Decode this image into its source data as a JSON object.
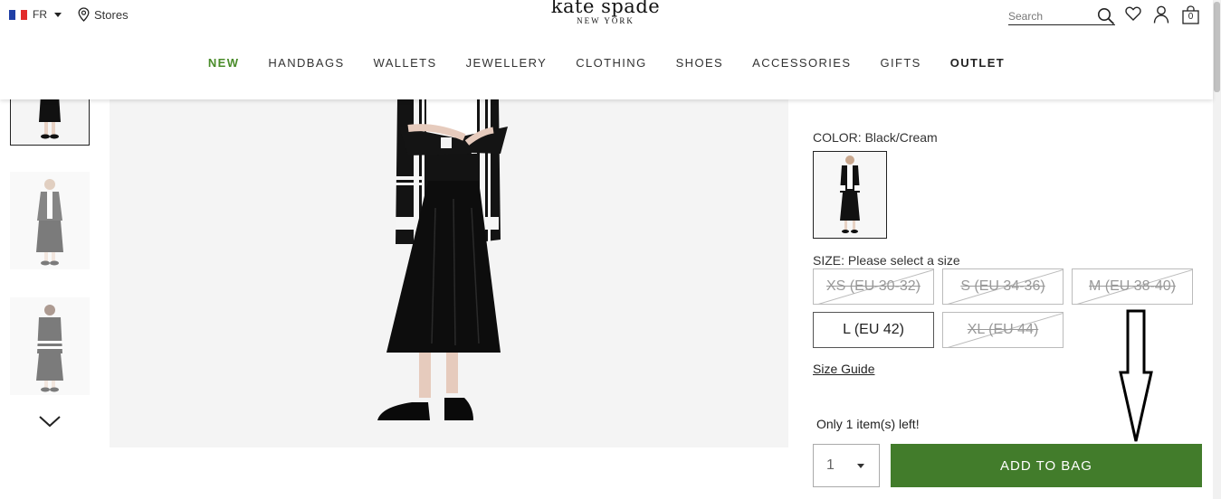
{
  "header": {
    "locale": "FR",
    "stores_label": "Stores",
    "logo_main": "kate spade",
    "logo_sub": "NEW YORK",
    "search_placeholder": "Search",
    "bag_count": "0"
  },
  "nav": {
    "items": [
      "NEW",
      "HANDBAGS",
      "WALLETS",
      "JEWELLERY",
      "CLOTHING",
      "SHOES",
      "ACCESSORIES",
      "GIFTS",
      "OUTLET"
    ]
  },
  "product": {
    "color_label": "COLOR:",
    "color_value": "Black/Cream",
    "size_label": "SIZE:",
    "size_prompt": "Please select a size",
    "sizes": [
      {
        "label": "XS (EU 30-32)",
        "available": false
      },
      {
        "label": "S (EU 34-36)",
        "available": false
      },
      {
        "label": "M (EU 38-40)",
        "available": false
      },
      {
        "label": "L (EU 42)",
        "available": true
      },
      {
        "label": "XL (EU 44)",
        "available": false
      }
    ],
    "size_guide": "Size Guide",
    "stock_note": "Only 1 item(s) left!",
    "quantity": "1",
    "add_to_bag": "ADD TO BAG"
  },
  "colors": {
    "new_accent": "#4a8c2a",
    "add_button": "#427c2b"
  }
}
